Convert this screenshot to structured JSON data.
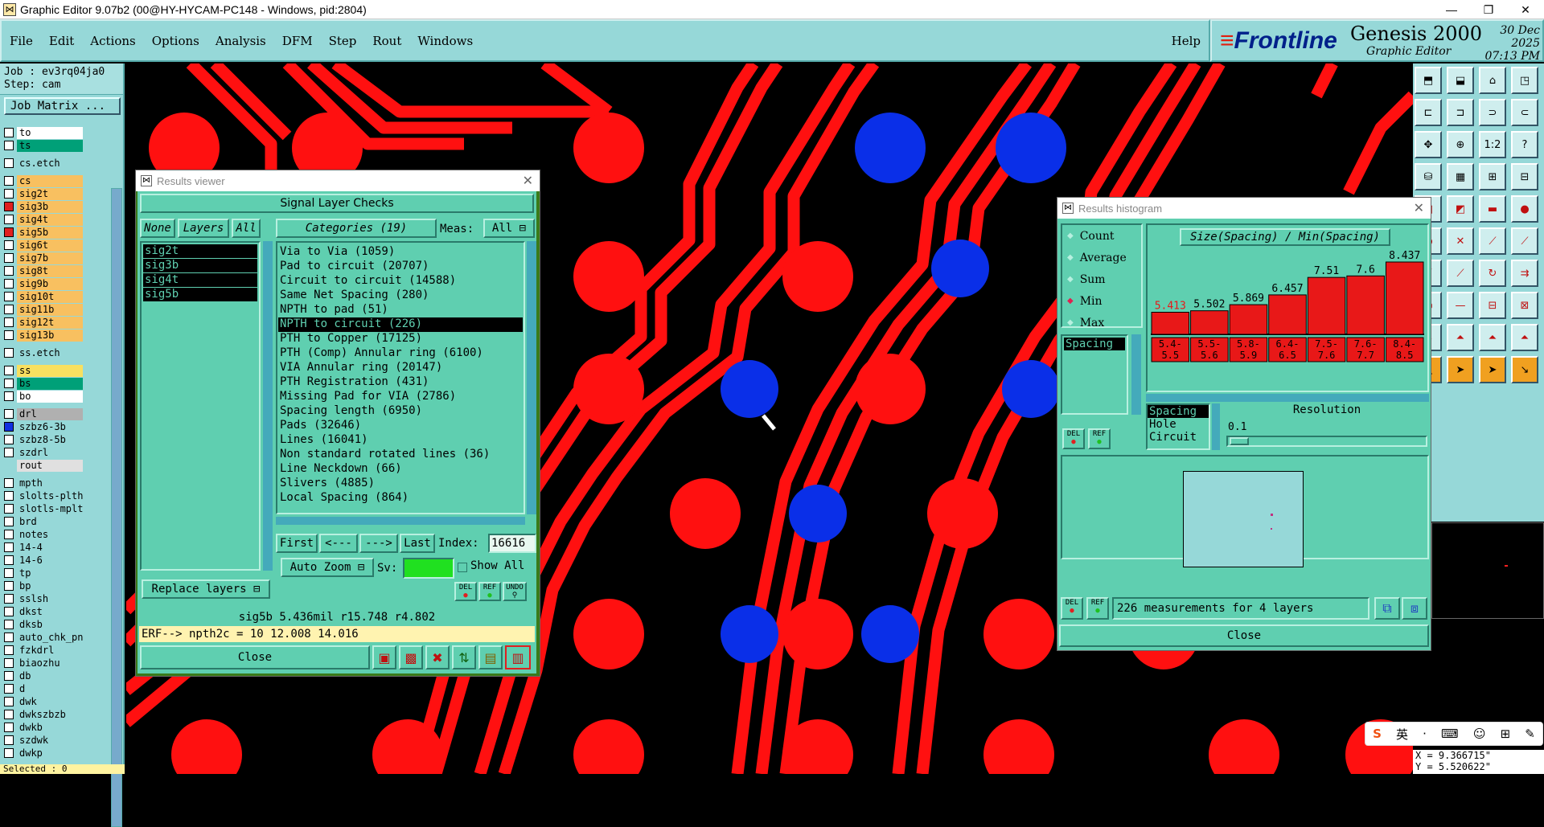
{
  "window": {
    "title": "Graphic Editor 9.07b2 (00@HY-HYCAM-PC148 - Windows, pid:2804)",
    "minimize": "—",
    "maximize": "❐",
    "close": "✕"
  },
  "menu": {
    "items": [
      "File",
      "Edit",
      "Actions",
      "Options",
      "Analysis",
      "DFM",
      "Step",
      "Rout",
      "Windows"
    ],
    "help": "Help"
  },
  "brand": {
    "logo_prefix": "Front",
    "logo_suffix": "line",
    "product": "Genesis 2000",
    "subtitle": "Graphic Editor",
    "date": "30 Dec 2025",
    "time": "07:13 PM"
  },
  "left": {
    "job": "Job : ev3rq04ja0",
    "step": "Step: cam",
    "job_matrix": "Job Matrix ...",
    "selected": "Selected : 0",
    "layers": [
      {
        "name": "to",
        "color": "#ffffff",
        "cb": true
      },
      {
        "name": "ts",
        "color": "#00a078",
        "cb": true
      },
      {
        "gap": true
      },
      {
        "name": "cs.etch",
        "color": "#96d8d8",
        "cb": true
      },
      {
        "gap": true
      },
      {
        "name": "cs",
        "color": "#f8c060",
        "cb": true
      },
      {
        "name": "sig2t",
        "color": "#f8c060",
        "cb": true
      },
      {
        "name": "sig3b",
        "color": "#f8c060",
        "cb": true,
        "red": true
      },
      {
        "name": "sig4t",
        "color": "#f8c060",
        "cb": true
      },
      {
        "name": "sig5b",
        "color": "#f8c060",
        "cb": true,
        "red": true
      },
      {
        "name": "sig6t",
        "color": "#f8c060",
        "cb": true
      },
      {
        "name": "sig7b",
        "color": "#f8c060",
        "cb": true
      },
      {
        "name": "sig8t",
        "color": "#f8c060",
        "cb": true
      },
      {
        "name": "sig9b",
        "color": "#f8c060",
        "cb": true
      },
      {
        "name": "sig10t",
        "color": "#f8c060",
        "cb": true
      },
      {
        "name": "sig11b",
        "color": "#f8c060",
        "cb": true
      },
      {
        "name": "sig12t",
        "color": "#f8c060",
        "cb": true
      },
      {
        "name": "sig13b",
        "color": "#f8c060",
        "cb": true
      },
      {
        "gap": true
      },
      {
        "name": "ss.etch",
        "color": "#96d8d8",
        "cb": true
      },
      {
        "gap": true
      },
      {
        "name": "ss",
        "color": "#f8e060",
        "cb": true
      },
      {
        "name": "bs",
        "color": "#00a078",
        "cb": true
      },
      {
        "name": "bo",
        "color": "#ffffff",
        "cb": true
      },
      {
        "gap": true
      },
      {
        "name": "drl",
        "color": "#b0b0b0",
        "cb": true
      },
      {
        "name": "szbz6-3b",
        "color": "#96d8d8",
        "cb": true,
        "blue": true
      },
      {
        "name": "szbz8-5b",
        "color": "#96d8d8",
        "cb": true
      },
      {
        "name": "szdrl",
        "color": "#96d8d8",
        "cb": true
      },
      {
        "name": "rout",
        "color": "#e0e0e0",
        "cb": false
      },
      {
        "gap": true
      },
      {
        "name": "mpth",
        "color": "#96d8d8",
        "cb": true
      },
      {
        "name": "slolts-plth",
        "color": "#96d8d8",
        "cb": true
      },
      {
        "name": "slotls-mplth",
        "color": "#96d8d8",
        "cb": true
      },
      {
        "name": "brd",
        "color": "#96d8d8",
        "cb": true
      },
      {
        "name": "notes",
        "color": "#96d8d8",
        "cb": true
      },
      {
        "name": "14-4",
        "color": "#96d8d8",
        "cb": true
      },
      {
        "name": "14-6",
        "color": "#96d8d8",
        "cb": true
      },
      {
        "name": "tp",
        "color": "#96d8d8",
        "cb": true
      },
      {
        "name": "bp",
        "color": "#96d8d8",
        "cb": true
      },
      {
        "name": "sslsh",
        "color": "#96d8d8",
        "cb": true
      },
      {
        "name": "dkst",
        "color": "#96d8d8",
        "cb": true
      },
      {
        "name": "dksb",
        "color": "#96d8d8",
        "cb": true
      },
      {
        "name": "auto_chk_pn..",
        "color": "#96d8d8",
        "cb": true
      },
      {
        "name": "fzkdrl",
        "color": "#96d8d8",
        "cb": true
      },
      {
        "name": "biaozhu",
        "color": "#96d8d8",
        "cb": true
      },
      {
        "name": "db",
        "color": "#96d8d8",
        "cb": true
      },
      {
        "name": "d",
        "color": "#96d8d8",
        "cb": true
      },
      {
        "name": "dwk",
        "color": "#96d8d8",
        "cb": true
      },
      {
        "name": "dwkszbzb",
        "color": "#96d8d8",
        "cb": true
      },
      {
        "name": "dwkb",
        "color": "#96d8d8",
        "cb": true
      },
      {
        "name": "szdwk",
        "color": "#96d8d8",
        "cb": true
      },
      {
        "name": "dwkp",
        "color": "#96d8d8",
        "cb": true
      }
    ]
  },
  "results_viewer": {
    "title": "Results viewer",
    "header": "Signal Layer Checks",
    "btn_none": "None",
    "btn_layers": "Layers",
    "btn_all": "All",
    "categories_label": "Categories (19)",
    "meas_label": "Meas:",
    "meas_value": "All",
    "layers": [
      "sig2t",
      "sig3b",
      "sig4t",
      "sig5b"
    ],
    "categories": [
      "Via to Via (1059)",
      "Pad to circuit (20707)",
      "Circuit to circuit (14588)",
      "Same Net Spacing (280)",
      "NPTH to pad (51)",
      "NPTH to circuit (226)",
      "PTH to Copper (17125)",
      "PTH (Comp) Annular ring (6100)",
      "VIA Annular ring (20147)",
      "PTH Registration (431)",
      "Missing Pad for VIA (2786)",
      "Spacing length (6950)",
      "Pads (32646)",
      "Lines (16041)",
      "Non standard rotated lines (36)",
      "Line Neckdown (66)",
      "Slivers (4885)",
      "Local Spacing (864)"
    ],
    "selected_index": 5,
    "nav": {
      "first": "First",
      "prev": "<---",
      "next": "--->",
      "last": "Last",
      "index_label": "Index:",
      "index_value": "16616"
    },
    "auto_zoom": "Auto Zoom",
    "sv_label": "Sv:",
    "show_all": "Show All",
    "replace_layers": "Replace layers",
    "del": "DEL",
    "ref": "REF",
    "undo": "UNDO",
    "status": "sig5b 5.436mil  r15.748  r4.802",
    "erf": "ERF--> npth2c = 10 12.008 14.016",
    "close": "Close"
  },
  "histogram": {
    "title": "Results histogram",
    "options": [
      "Count",
      "Average",
      "Sum",
      "Min",
      "Max"
    ],
    "selected_option": "Min",
    "list_item": "Spacing",
    "chart_title": "Size(Spacing) / Min(Spacing)",
    "types": [
      "Spacing",
      "Hole",
      "Circuit"
    ],
    "resolution_label": "Resolution",
    "resolution_value": "0.1",
    "summary": "226 measurements for 4 layers",
    "del": "DEL",
    "ref": "REF",
    "close": "Close"
  },
  "chart_data": {
    "type": "bar",
    "title": "Size(Spacing) / Min(Spacing)",
    "categories": [
      "5.4-5.5",
      "5.5-5.6",
      "5.8-5.9",
      "6.4-6.5",
      "7.5-7.6",
      "7.6-7.7",
      "8.4-8.5"
    ],
    "values": [
      5.413,
      5.502,
      5.869,
      6.457,
      7.51,
      7.6,
      8.437
    ],
    "labels": [
      "5.413",
      "5.502",
      "5.869",
      "6.457",
      "7.51",
      "7.6",
      "8.437"
    ],
    "bar_color": "#e81818",
    "first_label_color": "#e81818",
    "ylim": [
      0,
      8.437
    ],
    "grid": false
  },
  "toolbar_right": {
    "b1_2": "1:2",
    "help": "?"
  },
  "coords": {
    "x": "X = 9.366715\"",
    "y": "Y = 5.520622\""
  },
  "ime": {
    "s": "S",
    "lang": "英",
    "dot": "·"
  }
}
